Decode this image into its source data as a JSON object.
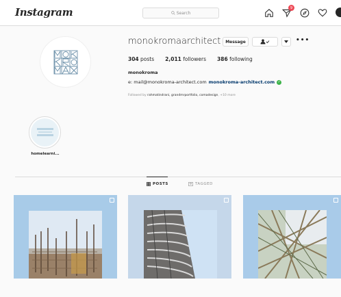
{
  "nav": {
    "logo": "Instagram",
    "search_placeholder": "Search",
    "notification_count": "9"
  },
  "profile": {
    "username": "monokromaarchitect",
    "message_button": "Message",
    "follow_button_icon": "person-check-icon",
    "posts_count": "304",
    "posts_label": "posts",
    "followers_count": "2,011",
    "followers_label": "followers",
    "following_count": "386",
    "following_label": "following",
    "full_name": "monokroma",
    "bio_email": "e: mail@monokroma-architect.com",
    "bio_link": "monokroma-architect.com",
    "followed_by_prefix": "Followed by",
    "followed_by_names": "rahmatindrani, grandmrportfolio, comadesign",
    "followed_by_more": "+10 more"
  },
  "highlights": [
    {
      "label": "homelearni..."
    }
  ],
  "tabs": [
    {
      "label": "POSTS",
      "active": true
    },
    {
      "label": "TAGGED",
      "active": false
    }
  ],
  "colors": {
    "verified": "#3db34a",
    "badge": "#ed4956",
    "link": "#00376b"
  }
}
